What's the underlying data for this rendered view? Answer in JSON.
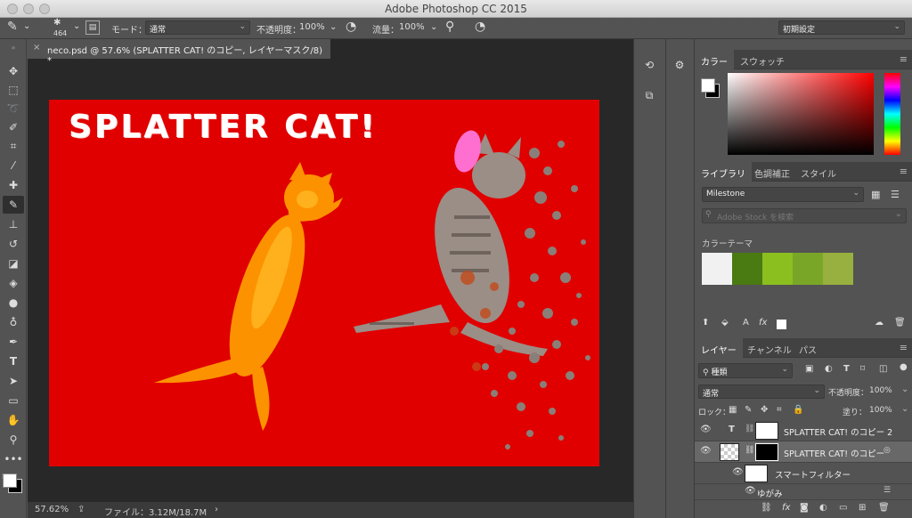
{
  "window": {
    "title": "Adobe Photoshop CC 2015"
  },
  "options_bar": {
    "brush_size": "464",
    "mode_label": "モード：",
    "mode_value": "通常",
    "opacity_label": "不透明度：",
    "opacity_value": "100%",
    "flow_label": "流量：",
    "flow_value": "100%",
    "workspace_value": "初期設定"
  },
  "document": {
    "tab_title": "neco.psd @ 57.6% (SPLATTER CAT! のコピー, レイヤーマスク/8) *",
    "canvas_text": "SPLATTER CAT!",
    "canvas_color": "#e00000"
  },
  "status": {
    "zoom": "57.62%",
    "file_info": "ファイル：3.12M/18.7M",
    "arrow": "›"
  },
  "color_panel": {
    "tabs": [
      "カラー",
      "スウォッチ"
    ],
    "foreground": "#ffffff",
    "background": "#000000",
    "hue": "#ff0000"
  },
  "library_panel": {
    "tabs": [
      "ライブラリ",
      "色調補正",
      "スタイル"
    ],
    "library_name": "Milestone",
    "search_placeholder": "Adobe Stock を検索",
    "theme_label": "カラーテーマ",
    "theme_colors": [
      "#f1f1f1",
      "#4a7a12",
      "#8bbf1f",
      "#7aa628",
      "#98b040"
    ],
    "fx_label": "fx"
  },
  "layers_panel": {
    "tabs": [
      "レイヤー",
      "チャンネル",
      "パス"
    ],
    "filter_value": "種類",
    "blend_mode": "通常",
    "opacity_label": "不透明度：",
    "opacity_value": "100%",
    "lock_label": "ロック：",
    "fill_label": "塗り：",
    "fill_value": "100%",
    "layers": [
      {
        "name": "SPLATTER CAT! のコピー 2"
      },
      {
        "name": "SPLATTER CAT! のコピー"
      },
      {
        "name": "スマートフィルター"
      },
      {
        "name": "ゆがみ"
      }
    ],
    "footer_fx": "fx"
  }
}
